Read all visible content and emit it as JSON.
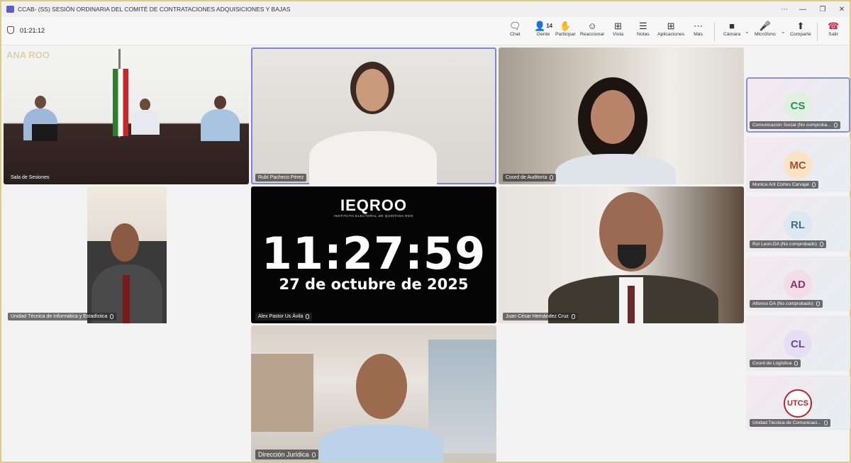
{
  "window": {
    "title": "CCAB- (SS) SESIÓN ORDINARIA DEL COMITÉ DE CONTRATACIONES ADQUISICIONES Y BAJAS",
    "controls": [
      "⋯",
      "—",
      "❐",
      "✕"
    ]
  },
  "toolbar": {
    "elapsed": "01:21:12",
    "chat": "Chat",
    "people": "Gente",
    "people_count": "14",
    "raise": "Participar",
    "react": "Reaccionar",
    "view": "Vista",
    "notes": "Notas",
    "apps": "Aplicaciones",
    "more": "Más",
    "camera": "Cámara",
    "mic": "Micrófono",
    "share": "Comparte",
    "leave": "Salir"
  },
  "tiles": {
    "room_watermark": "ANA ROO",
    "room": "Sala de Sesiones",
    "rubi": "Rubí Pacheco Pérez",
    "auditoria": "Coord de Auditoría",
    "informatica": "Unidad Técnica de Informática y Estadística",
    "alex": "Alex Pastor Us Ávila",
    "juan": "Juan César Hernández Cruz",
    "juridica": "Dirección Jurídica"
  },
  "clock": {
    "logo": "IEQROO",
    "logo_sub": "INSTITUTO ELECTORAL DE QUINTANA ROO",
    "time": "11:27:59",
    "date": "27 de octubre de 2025"
  },
  "sidebar": [
    {
      "initials": "CS",
      "name": "Comunicación Social (No comproba...",
      "color": "#2e8b57",
      "bg": "#dff0e0"
    },
    {
      "initials": "MC",
      "name": "Monica Arit Cortes Carvajal",
      "color": "#a0522d",
      "bg": "#fbe3c6"
    },
    {
      "initials": "RL",
      "name": "Rut Leon-DA (No comprobado)",
      "color": "#4a6a8a",
      "bg": "#dde8f2"
    },
    {
      "initials": "AD",
      "name": "Alfonso DA (No comprobado)",
      "color": "#8a3a6a",
      "bg": "#f3dbe8"
    },
    {
      "initials": "CL",
      "name": "Coord de Logística",
      "color": "#6a4a9a",
      "bg": "#e6def2"
    },
    {
      "initials": "UTCS",
      "name": "Unidad Técnica de Comunicaci...",
      "color": "#c0202a",
      "bg": "#ffffff"
    }
  ]
}
